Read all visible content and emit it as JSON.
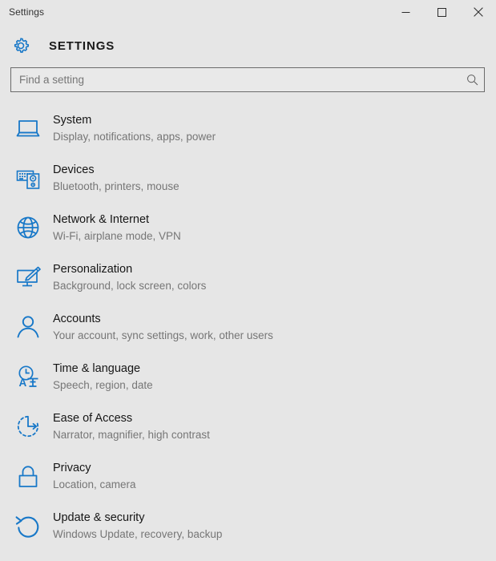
{
  "window": {
    "title": "Settings",
    "controls": [
      {
        "name": "minimize",
        "label": "Minimize"
      },
      {
        "name": "maximize",
        "label": "Maximize"
      },
      {
        "name": "close",
        "label": "Close"
      }
    ]
  },
  "header": {
    "title": "SETTINGS",
    "icon": "gear-icon"
  },
  "search": {
    "placeholder": "Find a setting",
    "value": "",
    "icon": "search-icon"
  },
  "colors": {
    "accent": "#0078d7",
    "icon_blue": "#1878c8",
    "background": "#e6e6e6",
    "title_text": "#161616",
    "subtitle_text": "#767676",
    "border": "#6b6b6b"
  },
  "settings": [
    {
      "icon": "laptop-icon",
      "title": "System",
      "subtitle": "Display, notifications, apps, power"
    },
    {
      "icon": "keyboard-mouse-icon",
      "title": "Devices",
      "subtitle": "Bluetooth, printers, mouse"
    },
    {
      "icon": "globe-icon",
      "title": "Network & Internet",
      "subtitle": "Wi-Fi, airplane mode, VPN"
    },
    {
      "icon": "paintbrush-monitor-icon",
      "title": "Personalization",
      "subtitle": "Background, lock screen, colors"
    },
    {
      "icon": "person-icon",
      "title": "Accounts",
      "subtitle": "Your account, sync settings, work, other users"
    },
    {
      "icon": "clock-language-icon",
      "title": "Time & language",
      "subtitle": "Speech, region, date"
    },
    {
      "icon": "accessibility-clock-icon",
      "title": "Ease of Access",
      "subtitle": "Narrator, magnifier, high contrast"
    },
    {
      "icon": "lock-icon",
      "title": "Privacy",
      "subtitle": "Location, camera"
    },
    {
      "icon": "refresh-icon",
      "title": "Update & security",
      "subtitle": "Windows Update, recovery, backup"
    }
  ]
}
